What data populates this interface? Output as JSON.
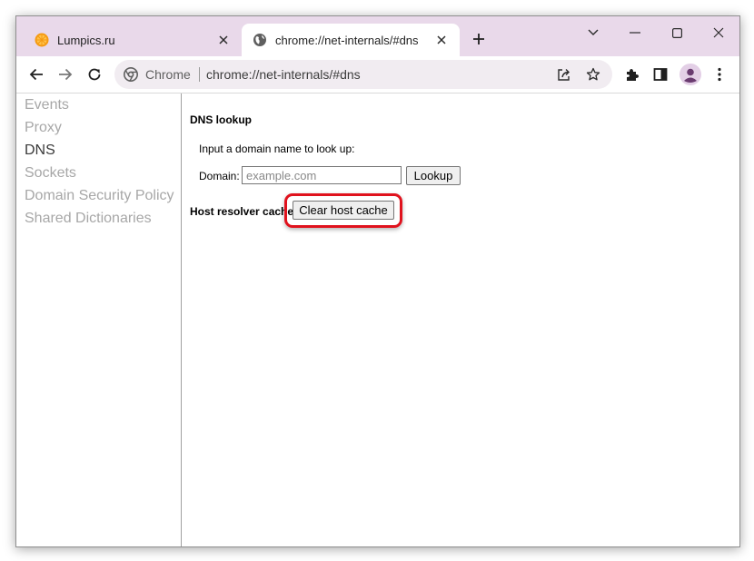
{
  "browser": {
    "tabs": [
      {
        "title": "Lumpics.ru",
        "active": false,
        "favicon": "orange-slice-icon"
      },
      {
        "title": "chrome://net-internals/#dns",
        "active": true,
        "favicon": "globe-icon"
      }
    ],
    "omnibox": {
      "scheme_label": "Chrome",
      "url": "chrome://net-internals/#dns"
    }
  },
  "sidebar": {
    "items": [
      {
        "label": "Events",
        "selected": false
      },
      {
        "label": "Proxy",
        "selected": false
      },
      {
        "label": "DNS",
        "selected": true
      },
      {
        "label": "Sockets",
        "selected": false
      },
      {
        "label": "Domain Security Policy",
        "selected": false
      },
      {
        "label": "Shared Dictionaries",
        "selected": false
      }
    ]
  },
  "dns": {
    "heading": "DNS lookup",
    "prompt": "Input a domain name to look up:",
    "domain_label": "Domain:",
    "domain_placeholder": "example.com",
    "domain_value": "",
    "lookup_button": "Lookup",
    "host_cache_heading": "Host resolver cache",
    "clear_button": "Clear host cache"
  },
  "colors": {
    "tabstrip_bg": "#e9d9ea",
    "highlight": "#e0121d",
    "sidebar_text": "#a7a7a7",
    "sidebar_selected": "#3a3a3a"
  }
}
